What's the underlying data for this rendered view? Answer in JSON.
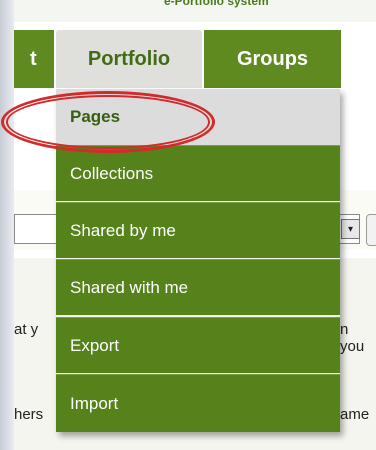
{
  "header": {
    "site_title": "e-Portfolio system"
  },
  "nav": {
    "partial_tab": "t",
    "portfolio_tab": "Portfolio",
    "groups_tab": "Groups"
  },
  "portfolio_menu": {
    "items": [
      {
        "label": "Pages",
        "active": true
      },
      {
        "label": "Collections"
      },
      {
        "label": "Shared by me"
      },
      {
        "label": "Shared with me"
      },
      {
        "label": "Export"
      },
      {
        "label": "Import"
      }
    ]
  },
  "background": {
    "text_left_1": "at y",
    "text_right_1": "n you",
    "text_left_2": "hers",
    "text_right_2": "ame",
    "select_arrow": "▾"
  },
  "colors": {
    "menu_green": "#56821b",
    "nav_green": "#5e8a1f",
    "active_grey": "#dcdcdc",
    "highlight_red": "#d42a2a"
  }
}
